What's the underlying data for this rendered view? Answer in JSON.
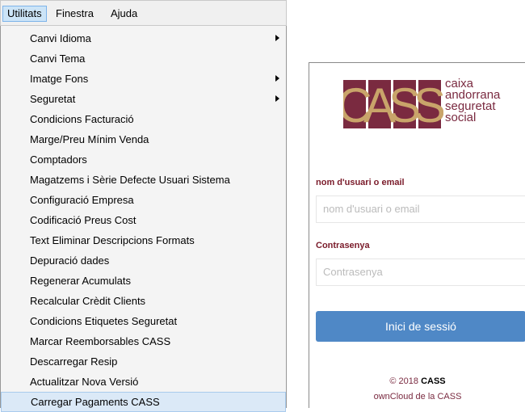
{
  "menubar": {
    "items": [
      {
        "label": "Utilitats"
      },
      {
        "label": "Finestra"
      },
      {
        "label": "Ajuda"
      }
    ]
  },
  "menu": {
    "items": [
      {
        "label": "Canvi Idioma",
        "submenu": true
      },
      {
        "label": "Canvi Tema",
        "submenu": false
      },
      {
        "label": "Imatge Fons",
        "submenu": true
      },
      {
        "label": "Seguretat",
        "submenu": true
      },
      {
        "label": "Condicions Facturació",
        "submenu": false
      },
      {
        "label": "Marge/Preu Mínim Venda",
        "submenu": false
      },
      {
        "label": "Comptadors",
        "submenu": false
      },
      {
        "label": "Magatzems i Sèrie Defecte Usuari Sistema",
        "submenu": false
      },
      {
        "label": "Configuració Empresa",
        "submenu": false
      },
      {
        "label": "Codificació Preus Cost",
        "submenu": false
      },
      {
        "label": "Text Eliminar Descripcions Formats",
        "submenu": false
      },
      {
        "label": "Depuració dades",
        "submenu": false
      },
      {
        "label": "Regenerar Acumulats",
        "submenu": false
      },
      {
        "label": "Recalcular Crèdit Clients",
        "submenu": false
      },
      {
        "label": "Condicions Etiquetes Seguretat",
        "submenu": false
      },
      {
        "label": "Marcar Reemborsables CASS",
        "submenu": false
      },
      {
        "label": "Descarregar Resip",
        "submenu": false
      },
      {
        "label": "Actualitzar Nova Versió",
        "submenu": false
      },
      {
        "label": "Carregar Pagaments CASS",
        "submenu": false,
        "highlighted": true
      }
    ]
  },
  "login": {
    "logo": {
      "letters": "CASS",
      "lines": [
        "caixa",
        "andorrana",
        "seguretat",
        "social"
      ]
    },
    "username_label": "nom d'usuari o email",
    "username_placeholder": "nom d'usuari o email",
    "password_label": "Contrasenya",
    "password_placeholder": "Contrasenya",
    "submit_label": "Inici de sessió",
    "footer_line1_prefix": "© 2018",
    "footer_line1_strong": "CASS",
    "footer_line2": "ownCloud de la CASS"
  },
  "colors": {
    "brand": "#7a2a40",
    "button": "#4f88c6",
    "menu_highlight": "#cce4f7"
  }
}
